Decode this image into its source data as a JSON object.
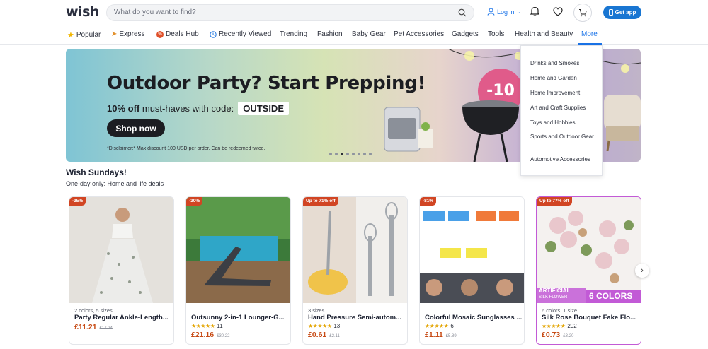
{
  "header": {
    "logo": "wish",
    "search_placeholder": "What do you want to find?",
    "login_label": "Log in",
    "get_app_label": "Get app"
  },
  "nav": {
    "items": [
      {
        "label": "Popular",
        "icon": "star-icon"
      },
      {
        "label": "Express",
        "icon": "express-icon"
      },
      {
        "label": "Deals Hub",
        "icon": "deals-icon"
      },
      {
        "label": "Recently Viewed",
        "icon": "clock-icon"
      },
      {
        "label": "Trending"
      },
      {
        "label": "Fashion"
      },
      {
        "label": "Baby Gear"
      },
      {
        "label": "Pet Accessories"
      },
      {
        "label": "Gadgets"
      },
      {
        "label": "Tools"
      },
      {
        "label": "Health and Beauty"
      },
      {
        "label": "More"
      }
    ]
  },
  "dropdown": {
    "items": [
      "Drinks and Smokes",
      "Home and Garden",
      "Home Improvement",
      "Art and Craft Supplies",
      "Toys and Hobbies",
      "Sports and Outdoor Gear",
      "Automotive Accessories"
    ]
  },
  "banner": {
    "title": "Outdoor Party? Start Prepping!",
    "sub_bold": "10% off",
    "sub_rest": "must-haves with code:",
    "code": "OUTSIDE",
    "cta": "Shop now",
    "disclaimer": "*Disclaimer:* Max discount 100 USD per order. Can be redeemed twice.",
    "sticker": "-10",
    "active_slide": 3,
    "slide_count": 8
  },
  "section": {
    "title": "Wish Sundays!",
    "subtitle": "One-day only: Home and life deals"
  },
  "products": [
    {
      "badge": "-35%",
      "variant": "2 colors, 5 sizes",
      "title": "Party Regular Ankle-Length...",
      "rating": null,
      "reviews": "",
      "price": "£11.21",
      "old_price": "£17.24"
    },
    {
      "badge": "-30%",
      "variant": "",
      "title": "Outsunny 2-in-1 Lounger-G...",
      "rating": 4.5,
      "reviews": "11",
      "price": "£21.16",
      "old_price": "£30.22"
    },
    {
      "badge": "Up to 71% off",
      "variant": "3 sizes",
      "title": "Hand Pressure Semi-autom...",
      "rating": 4.5,
      "reviews": "13",
      "price": "£0.61",
      "old_price": "£2.11"
    },
    {
      "badge": "-81%",
      "variant": "",
      "title": "Colorful Mosaic Sunglasses ...",
      "rating": 5,
      "reviews": "6",
      "price": "£1.11",
      "old_price": "£5.89"
    },
    {
      "badge": "Up to 77% off",
      "variant": "6 colors, 1 size",
      "title": "Silk Rose Bouquet Fake Flo...",
      "rating": 4.5,
      "reviews": "202",
      "price": "£0.73",
      "old_price": "£3.20"
    }
  ],
  "product_overlay": {
    "flower_tag_1": "ARTIFICIAL",
    "flower_tag_2": "SILK FLOWER",
    "flower_colors": "6 COLORS"
  },
  "colors": {
    "brand_blue": "#1976d2",
    "price_orange": "#c74a14",
    "badge_red": "#d14523",
    "star_gold": "#e3a400"
  }
}
